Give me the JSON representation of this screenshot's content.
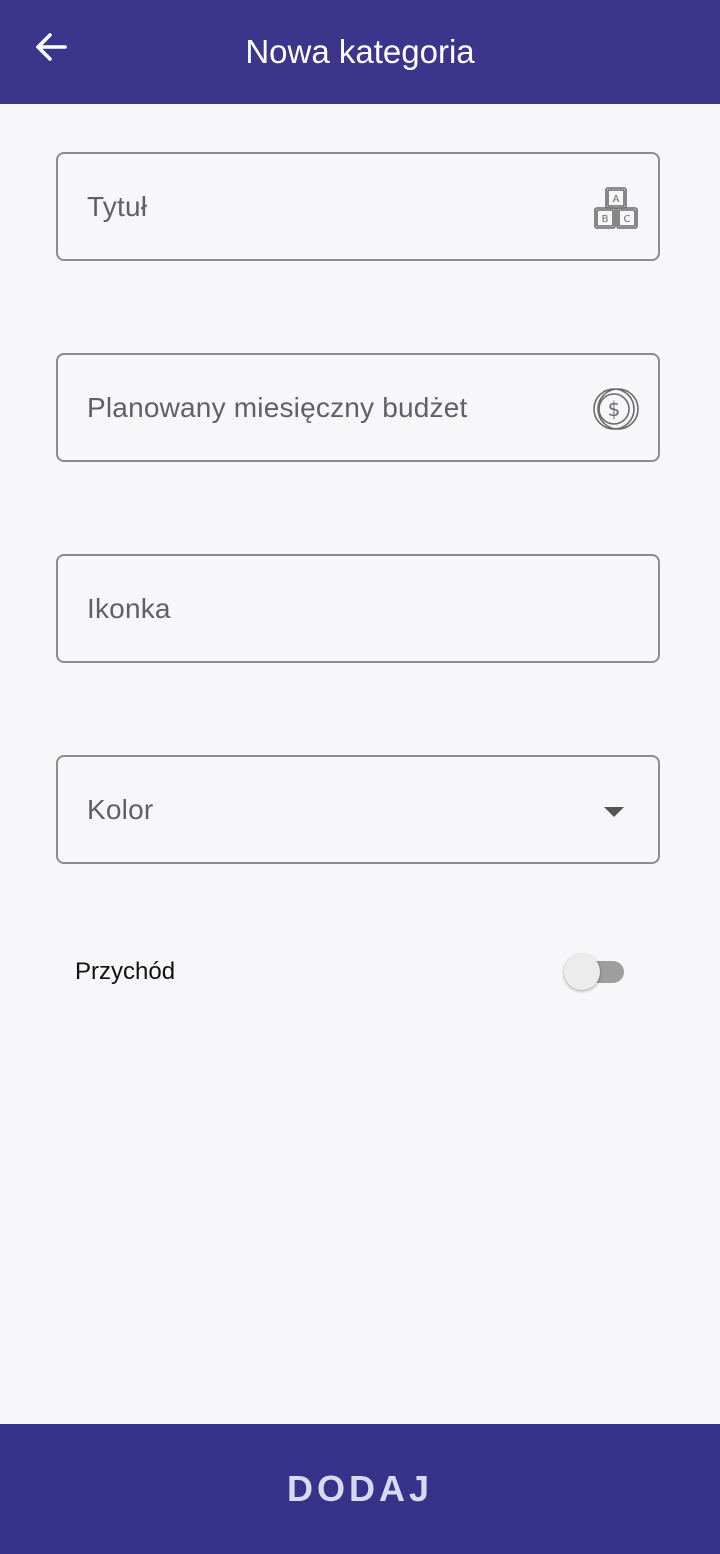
{
  "app_bar": {
    "title": "Nowa kategoria",
    "back_icon": "arrow-left-icon",
    "background": "#3b368c"
  },
  "form": {
    "title_field": {
      "placeholder": "Tytuł",
      "value": "",
      "icon": "abc-blocks-icon"
    },
    "budget_field": {
      "placeholder": "Planowany miesięczny budżet",
      "value": "",
      "icon": "coin-dollar-icon"
    },
    "icon_field": {
      "placeholder": "Ikonka",
      "value": ""
    },
    "color_field": {
      "placeholder": "Kolor",
      "value": "",
      "icon": "dropdown-arrow-icon"
    },
    "income_switch": {
      "label": "Przychód",
      "checked": false
    }
  },
  "submit_button": {
    "label": "DODAJ",
    "background": "#37338a"
  }
}
